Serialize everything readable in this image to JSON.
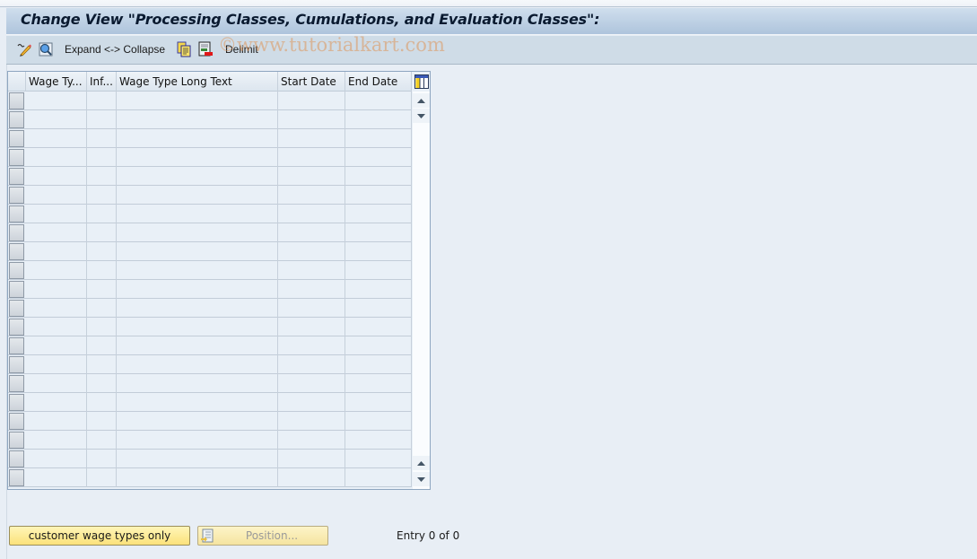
{
  "window": {
    "title": "Change View \"Processing Classes, Cumulations, and Evaluation Classes\":"
  },
  "toolbar": {
    "items": [
      {
        "name": "display-change-icon",
        "label": ""
      },
      {
        "name": "details-icon",
        "label": ""
      },
      {
        "name": "expand-collapse",
        "label": "Expand <-> Collapse"
      },
      {
        "name": "copy-icon",
        "label": ""
      },
      {
        "name": "delete-icon",
        "label": ""
      },
      {
        "name": "delimit",
        "label": "Delimit"
      }
    ],
    "expand_collapse_label": "Expand <-> Collapse",
    "delimit_label": "Delimit"
  },
  "watermark": "©www.tutorialkart.com",
  "table": {
    "columns": [
      {
        "key": "wage_type",
        "label": "Wage Ty..."
      },
      {
        "key": "inf",
        "label": "Inf..."
      },
      {
        "key": "long_text",
        "label": "Wage Type Long Text"
      },
      {
        "key": "start_date",
        "label": "Start Date"
      },
      {
        "key": "end_date",
        "label": "End Date"
      }
    ],
    "row_count": 21,
    "rows": []
  },
  "footer": {
    "customer_button_label": "customer wage types only",
    "position_button_label": "Position...",
    "entry_text": "Entry 0 of 0"
  },
  "colors": {
    "title_bar": "#aec4dc",
    "toolbar": "#cfdce7",
    "background": "#e8eef5",
    "button_yellow": "#fbe27a"
  }
}
